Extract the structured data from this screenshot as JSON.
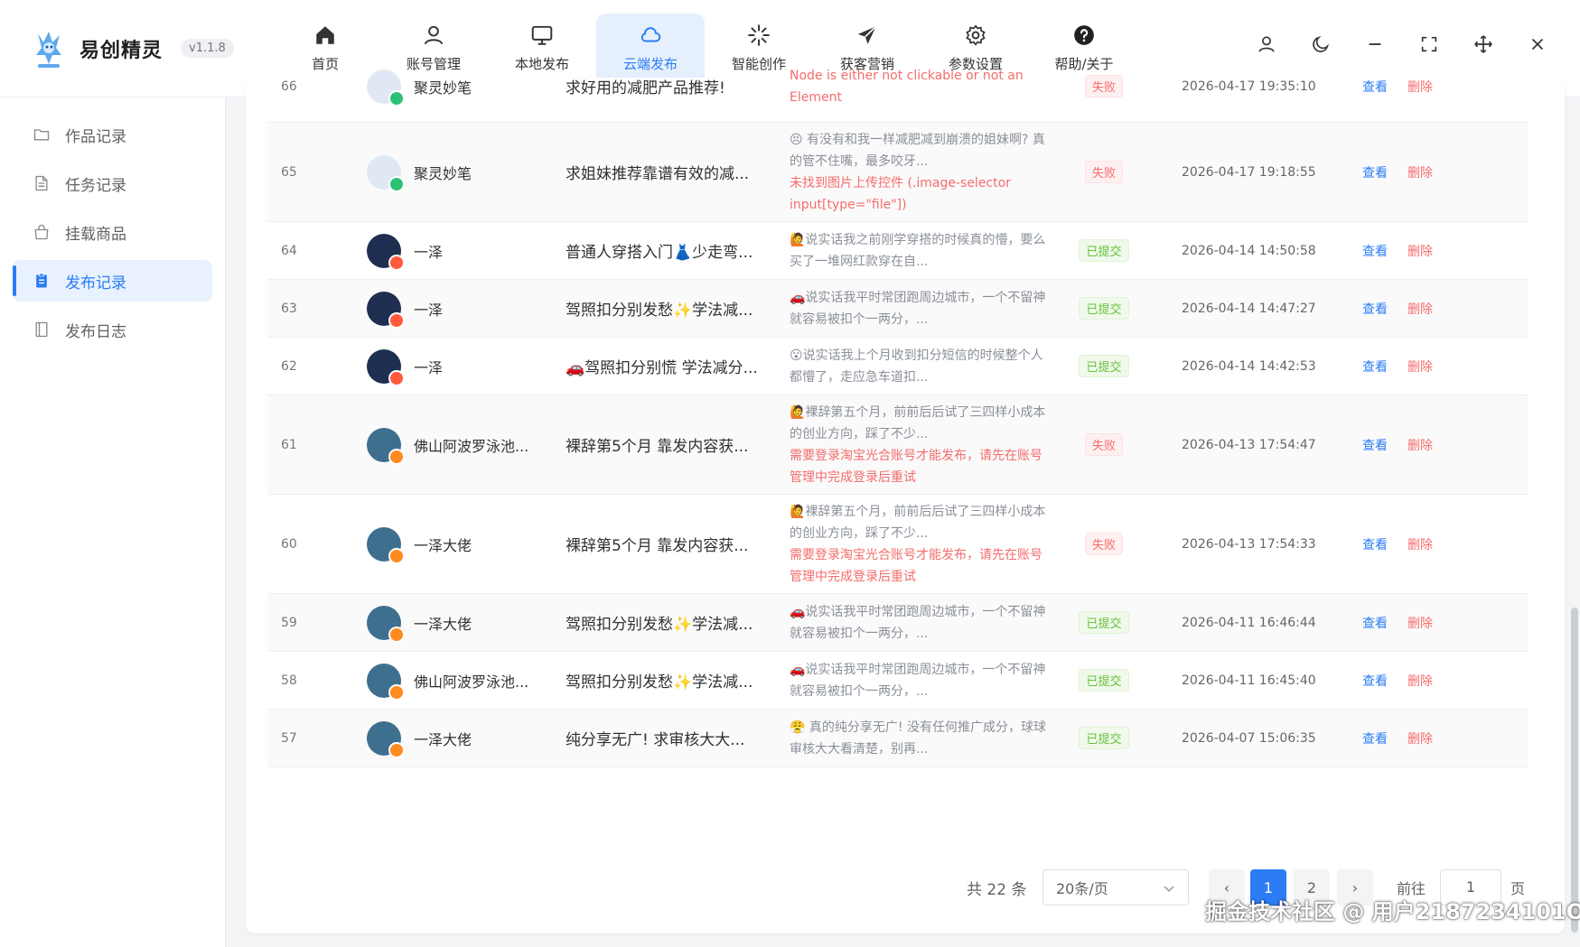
{
  "app": {
    "name": "易创精灵",
    "version": "v1.1.8"
  },
  "nav": [
    {
      "label": "首页",
      "icon": "home-icon"
    },
    {
      "label": "账号管理",
      "icon": "user-icon"
    },
    {
      "label": "本地发布",
      "icon": "monitor-icon"
    },
    {
      "label": "云端发布",
      "icon": "cloud-icon",
      "active": true
    },
    {
      "label": "智能创作",
      "icon": "sparkle-icon"
    },
    {
      "label": "获客营销",
      "icon": "send-icon"
    },
    {
      "label": "参数设置",
      "icon": "gear-icon"
    },
    {
      "label": "帮助/关于",
      "icon": "help-icon"
    }
  ],
  "sidebar": [
    {
      "label": "作品记录",
      "icon": "folder-icon"
    },
    {
      "label": "任务记录",
      "icon": "document-icon"
    },
    {
      "label": "挂载商品",
      "icon": "bag-icon"
    },
    {
      "label": "发布记录",
      "icon": "clipboard-icon",
      "active": true
    },
    {
      "label": "发布日志",
      "icon": "notebook-icon"
    }
  ],
  "records": [
    {
      "id": "66",
      "account": "聚灵妙笔",
      "platform": "green",
      "title": "求好用的减肥产品推荐!",
      "desc": "",
      "error": "Node is either not clickable or not an Element",
      "status": "失败",
      "time": "2026-04-17 19:35:10"
    },
    {
      "id": "65",
      "account": "聚灵妙笔",
      "platform": "green",
      "title": "求姐妹推荐靠谱有效的减...",
      "desc": "😣 有没有和我一样减肥减到崩溃的姐妹啊? 真的管不住嘴，最多咬牙...",
      "error": "未找到图片上传控件 (.image-selector input[type=\"file\"])",
      "status": "失败",
      "time": "2026-04-17 19:18:55"
    },
    {
      "id": "64",
      "account": "一泽",
      "platform": "red",
      "title": "普通人穿搭入门👗少走弯...",
      "desc": "🙋说实话我之前刚学穿搭的时候真的懵，要么买了一堆网红款穿在自...",
      "error": "",
      "status": "已提交",
      "time": "2026-04-14 14:50:58"
    },
    {
      "id": "63",
      "account": "一泽",
      "platform": "red",
      "title": "驾照扣分别发愁✨学法减...",
      "desc": "🚗说实话我平时常团跑周边城市，一个不留神就容易被扣个一两分，...",
      "error": "",
      "status": "已提交",
      "time": "2026-04-14 14:47:27"
    },
    {
      "id": "62",
      "account": "一泽",
      "platform": "red",
      "title": "🚗驾照扣分别慌 学法减分...",
      "desc": "😮说实话我上个月收到扣分短信的时候整个人都懵了，走应急车道扣...",
      "error": "",
      "status": "已提交",
      "time": "2026-04-14 14:42:53"
    },
    {
      "id": "61",
      "account": "佛山阿波罗泳池...",
      "platform": "orange",
      "title": "裸辞第5个月 靠发内容获...",
      "desc": "🙋裸辞第五个月，前前后后试了三四样小成本的创业方向，踩了不少...",
      "error": "需要登录淘宝光合账号才能发布，请先在账号管理中完成登录后重试",
      "status": "失败",
      "time": "2026-04-13 17:54:47"
    },
    {
      "id": "60",
      "account": "一泽大佬",
      "platform": "orange",
      "title": "裸辞第5个月 靠发内容获...",
      "desc": "🙋裸辞第五个月，前前后后试了三四样小成本的创业方向，踩了不少...",
      "error": "需要登录淘宝光合账号才能发布，请先在账号管理中完成登录后重试",
      "status": "失败",
      "time": "2026-04-13 17:54:33"
    },
    {
      "id": "59",
      "account": "一泽大佬",
      "platform": "orange",
      "title": "驾照扣分别发愁✨学法减...",
      "desc": "🚗说实话我平时常团跑周边城市，一个不留神就容易被扣个一两分，...",
      "error": "",
      "status": "已提交",
      "time": "2026-04-11 16:46:44"
    },
    {
      "id": "58",
      "account": "佛山阿波罗泳池...",
      "platform": "orange",
      "title": "驾照扣分别发愁✨学法减...",
      "desc": "🚗说实话我平时常团跑周边城市，一个不留神就容易被扣个一两分，...",
      "error": "",
      "status": "已提交",
      "time": "2026-04-11 16:45:40"
    },
    {
      "id": "57",
      "account": "一泽大佬",
      "platform": "orange",
      "title": "纯分享无广! 求审核大大...",
      "desc": "😤 真的纯分享无广! 没有任何推广成分，球球审核大大看清楚，别再...",
      "error": "",
      "status": "已提交",
      "time": "2026-04-07 15:06:35"
    }
  ],
  "ops": {
    "view": "查看",
    "delete": "删除"
  },
  "pagination": {
    "total": "共 22 条",
    "page_size": "20条/页",
    "pages": [
      "1",
      "2"
    ],
    "next": "›",
    "goto": "前往",
    "goto_value": "1",
    "page_unit": "页"
  },
  "watermark": "掘金技术社区 @ 用户2187234101O",
  "colors": {
    "accent": "#2b7cf5",
    "danger": "#f56c6c",
    "success": "#67c23a"
  }
}
